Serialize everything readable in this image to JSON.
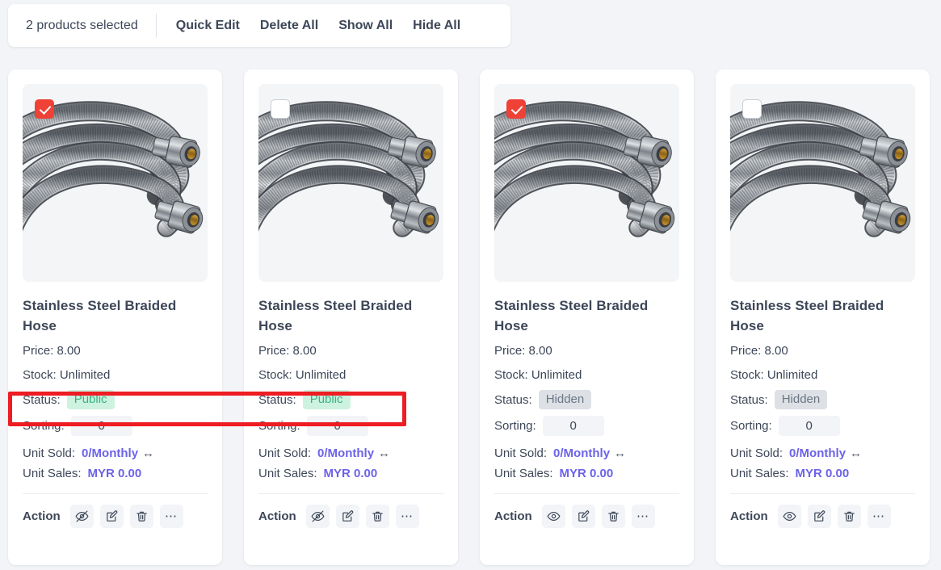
{
  "toolbar": {
    "selection_label": "2 products selected",
    "actions": [
      {
        "label": "Quick Edit",
        "name": "quick-edit"
      },
      {
        "label": "Delete All",
        "name": "delete-all"
      },
      {
        "label": "Show All",
        "name": "show-all"
      },
      {
        "label": "Hide All",
        "name": "hide-all"
      }
    ]
  },
  "labels": {
    "price_prefix": "Price: ",
    "stock_prefix": "Stock: ",
    "status": "Status:",
    "sorting": "Sorting:",
    "unit_sold": "Unit Sold:",
    "unit_sales": "Unit Sales:",
    "action": "Action",
    "arrow_glyph": "↔",
    "dots_glyph": "⋯"
  },
  "colors": {
    "page_background": "#f2f4f7",
    "card_background": "#ffffff",
    "checkbox_checked": "#ef4136",
    "badge_public_bg": "#cdf2e0",
    "badge_public_text": "#39b37e",
    "badge_hidden_bg": "#dde1e6",
    "badge_hidden_text": "#6b7684",
    "link": "#6c63e8",
    "annotation": "#ee1c23",
    "text": "#3d4758"
  },
  "products": [
    {
      "title": "Stainless Steel Braided Hose",
      "price": "8.00",
      "stock": "Unlimited",
      "status": "Public",
      "status_kind": "public",
      "sorting": "0",
      "unit_sold": "0/Monthly",
      "unit_sales": "MYR 0.00",
      "selected": true,
      "visibility_icon": "eye-off-icon"
    },
    {
      "title": "Stainless Steel Braided Hose",
      "price": "8.00",
      "stock": "Unlimited",
      "status": "Public",
      "status_kind": "public",
      "sorting": "0",
      "unit_sold": "0/Monthly",
      "unit_sales": "MYR 0.00",
      "selected": false,
      "visibility_icon": "eye-off-icon"
    },
    {
      "title": "Stainless Steel Braided Hose",
      "price": "8.00",
      "stock": "Unlimited",
      "status": "Hidden",
      "status_kind": "hidden",
      "sorting": "0",
      "unit_sold": "0/Monthly",
      "unit_sales": "MYR 0.00",
      "selected": true,
      "visibility_icon": "eye-icon"
    },
    {
      "title": "Stainless Steel Braided Hose",
      "price": "8.00",
      "stock": "Unlimited",
      "status": "Hidden",
      "status_kind": "hidden",
      "sorting": "0",
      "unit_sold": "0/Monthly",
      "unit_sales": "MYR 0.00",
      "selected": false,
      "visibility_icon": "eye-icon"
    }
  ]
}
